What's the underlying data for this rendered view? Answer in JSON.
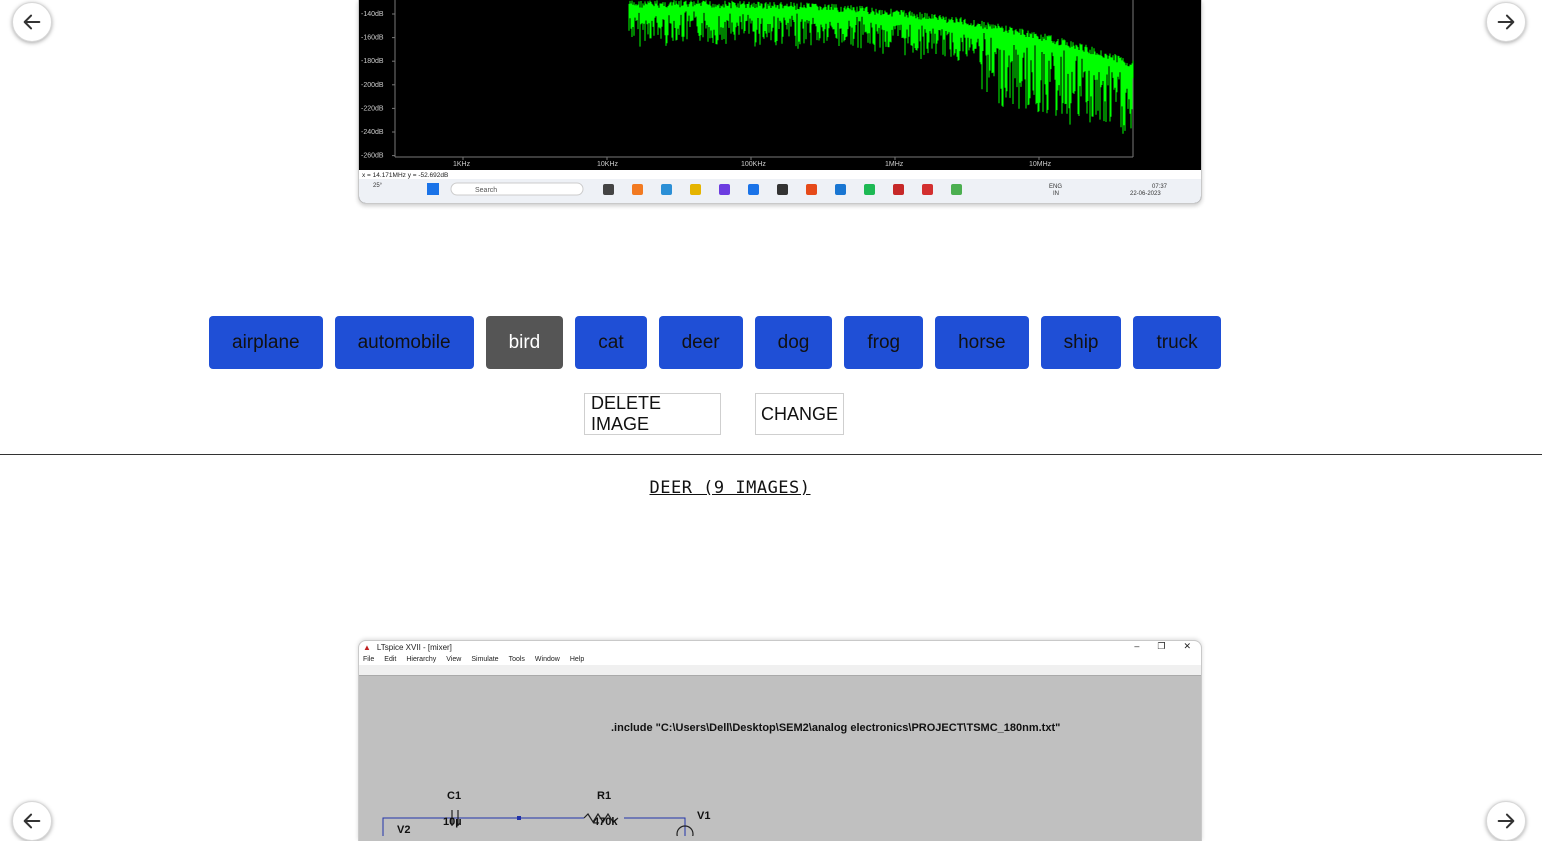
{
  "classes": [
    {
      "label": "airplane",
      "selected": false
    },
    {
      "label": "automobile",
      "selected": false
    },
    {
      "label": "bird",
      "selected": true
    },
    {
      "label": "cat",
      "selected": false
    },
    {
      "label": "deer",
      "selected": false
    },
    {
      "label": "dog",
      "selected": false
    },
    {
      "label": "frog",
      "selected": false
    },
    {
      "label": "horse",
      "selected": false
    },
    {
      "label": "ship",
      "selected": false
    },
    {
      "label": "truck",
      "selected": false
    }
  ],
  "actions": {
    "delete_label": "DELETE IMAGE",
    "change_label": "CHANGE"
  },
  "section": {
    "title": "DEER (9 IMAGES)"
  },
  "top_image": {
    "y_ticks": [
      "-140dB",
      "-160dB",
      "-180dB",
      "-200dB",
      "-220dB",
      "-240dB",
      "-260dB"
    ],
    "x_ticks": [
      "1KHz",
      "10KHz",
      "100KHz",
      "1MHz",
      "10MHz"
    ],
    "cursor_readout": "x = 14.171MHz    y = -52.692dB",
    "taskbar": {
      "search": "Search",
      "lang_top": "ENG",
      "lang_bottom": "IN",
      "time": "07:37",
      "date": "22-06-2023",
      "temp": "25°"
    },
    "trace_color": "#00ff00"
  },
  "bottom_image": {
    "window_title": "LTspice XVII - [mixer]",
    "menu": [
      "File",
      "Edit",
      "Hierarchy",
      "View",
      "Simulate",
      "Tools",
      "Window",
      "Help"
    ],
    "include_text": ".include \"C:\\Users\\Dell\\Desktop\\SEM2\\analog electronics\\PROJECT\\TSMC_180nm.txt\"",
    "components": [
      {
        "name": "C1",
        "value": "10µ"
      },
      {
        "name": "R1",
        "value": "470k"
      },
      {
        "name": "V1",
        "value": ""
      },
      {
        "name": "V2",
        "value": ""
      }
    ]
  },
  "colors": {
    "class_button": "#1f4fd6",
    "selected_button": "#555555"
  }
}
